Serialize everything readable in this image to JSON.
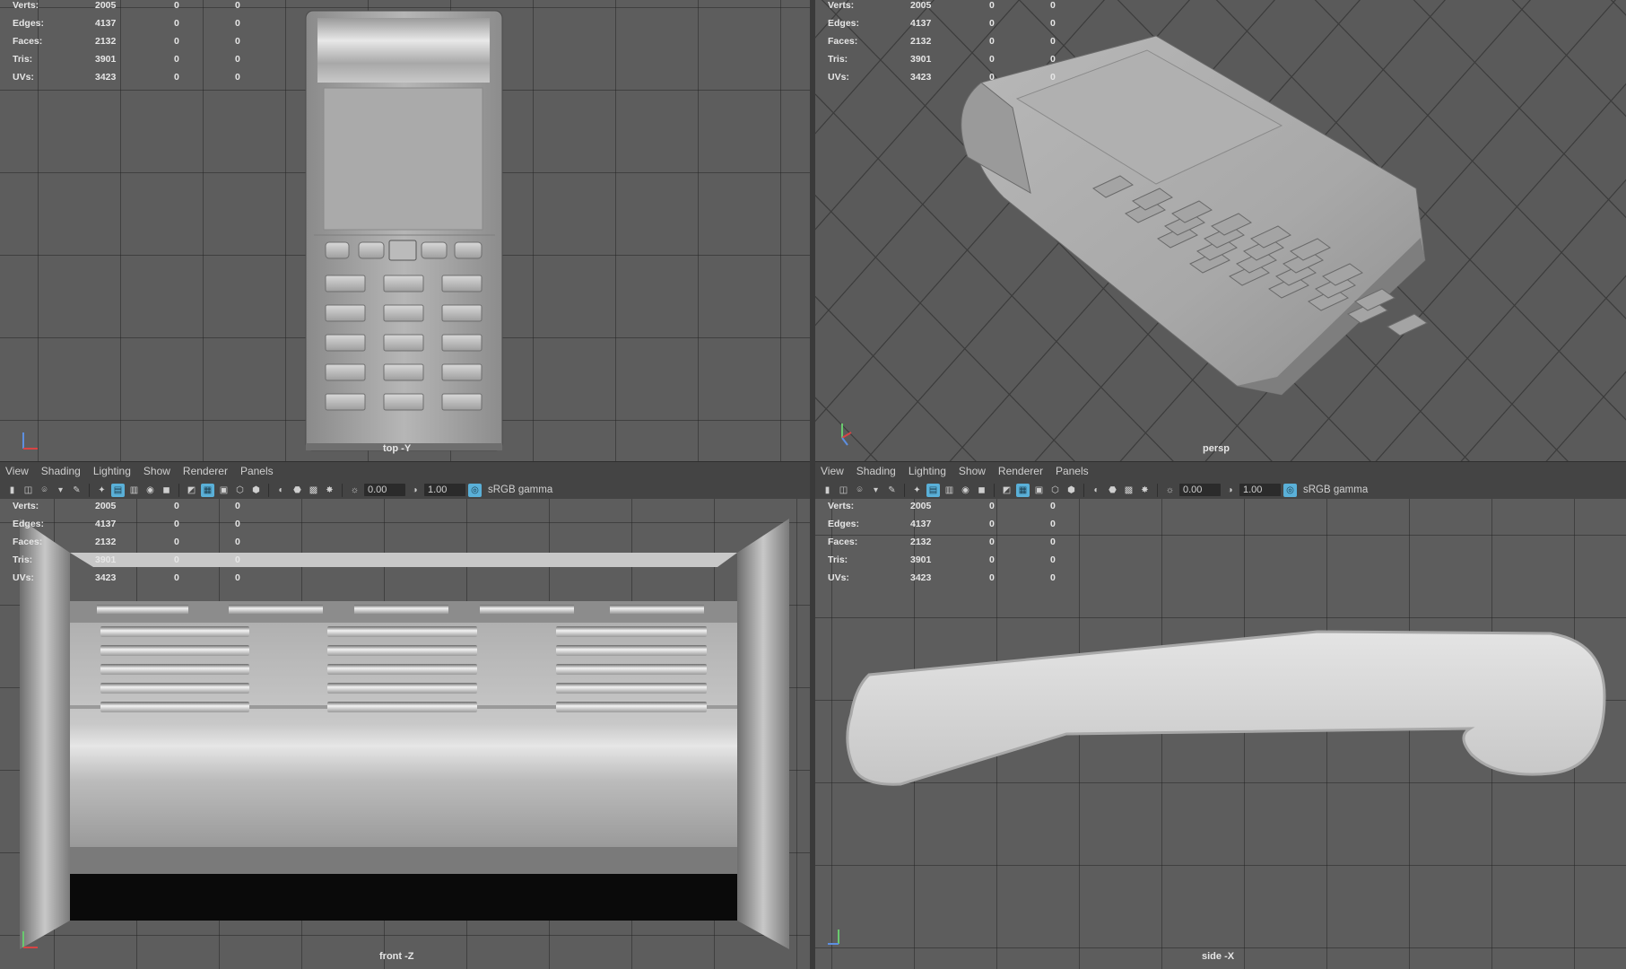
{
  "panel_menu": [
    "View",
    "Shading",
    "Lighting",
    "Show",
    "Renderer",
    "Panels"
  ],
  "toolbar": {
    "exposure": "0.00",
    "gamma": "1.00",
    "color_space": "sRGB gamma"
  },
  "hud": {
    "rows": [
      {
        "label": "Verts:",
        "a": "2005",
        "b": "0",
        "c": "0"
      },
      {
        "label": "Edges:",
        "a": "4137",
        "b": "0",
        "c": "0"
      },
      {
        "label": "Faces:",
        "a": "2132",
        "b": "0",
        "c": "0"
      },
      {
        "label": "Tris:",
        "a": "3901",
        "b": "0",
        "c": "0"
      },
      {
        "label": "UVs:",
        "a": "3423",
        "b": "0",
        "c": "0"
      }
    ]
  },
  "cameras": {
    "top": "top -Y",
    "persp": "persp",
    "front": "front -Z",
    "side": "side -X"
  },
  "colors": {
    "viewport_bg": "#5d5d5d",
    "active_tool": "#5ab0d8",
    "grid_line": "#3a3a3a"
  }
}
